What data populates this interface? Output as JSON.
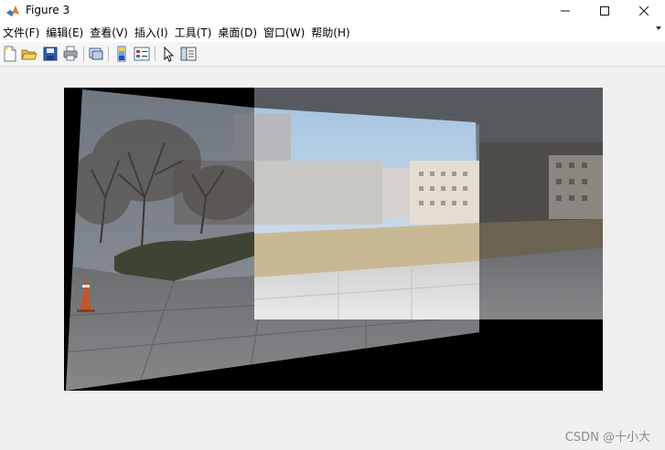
{
  "window": {
    "title": "Figure 3",
    "minimize_icon": "minimize-icon",
    "maximize_icon": "maximize-icon",
    "close_icon": "close-icon"
  },
  "menubar": {
    "items": [
      {
        "label": "文件(F)"
      },
      {
        "label": "编辑(E)"
      },
      {
        "label": "查看(V)"
      },
      {
        "label": "插入(I)"
      },
      {
        "label": "工具(T)"
      },
      {
        "label": "桌面(D)"
      },
      {
        "label": "窗口(W)"
      },
      {
        "label": "帮助(H)"
      }
    ]
  },
  "toolbar": {
    "buttons": [
      {
        "icon": "new-figure-icon"
      },
      {
        "icon": "open-file-icon"
      },
      {
        "icon": "save-icon"
      },
      {
        "icon": "print-icon"
      },
      {
        "icon": "link-plot-icon"
      },
      {
        "icon": "insert-colorbar-icon"
      },
      {
        "icon": "insert-legend-icon"
      },
      {
        "icon": "edit-plot-icon"
      },
      {
        "icon": "property-inspector-icon"
      }
    ]
  },
  "figure": {
    "content": "stitched panorama image",
    "background": "#000000"
  },
  "watermark": "CSDN @十小大"
}
